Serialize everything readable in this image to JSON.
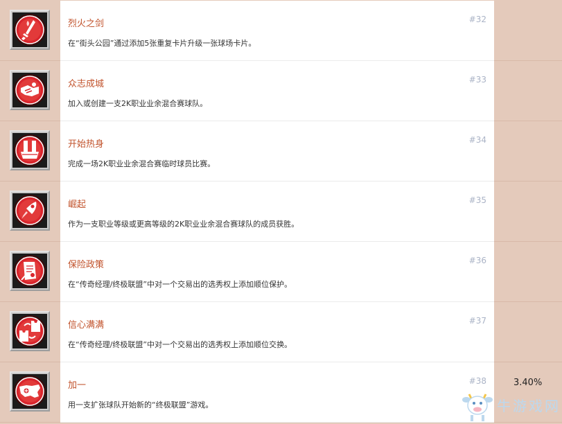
{
  "rows": [
    {
      "title": "烈火之剑",
      "desc": "在“街头公园”通过添加5张重复卡片升级一张球场卡片。",
      "num": "#32",
      "pct": "",
      "icon": "flaming-sword-icon"
    },
    {
      "title": "众志成城",
      "desc": "加入或创建一支2K职业业余混合赛球队。",
      "num": "#33",
      "pct": "",
      "icon": "handshake-icon"
    },
    {
      "title": "开始热身",
      "desc": "完成一场2K职业业余混合赛临时球员比赛。",
      "num": "#34",
      "pct": "",
      "icon": "warmup-bucket-icon"
    },
    {
      "title": "崛起",
      "desc": "作为一支职业等级或更高等级的2K职业业余混合赛球队的成员获胜。",
      "num": "#35",
      "pct": "",
      "icon": "rocket-icon"
    },
    {
      "title": "保险政策",
      "desc": "在“传奇经理/终极联盟”中对一个交易出的选秀权上添加顺位保护。",
      "num": "#36",
      "pct": "",
      "icon": "policy-document-icon"
    },
    {
      "title": "信心满满",
      "desc": "在“传奇经理/终极联盟”中对一个交易出的选秀权上添加顺位交换。",
      "num": "#37",
      "pct": "",
      "icon": "jersey-swap-icon"
    },
    {
      "title": "加一",
      "desc": "用一支扩张球队开始新的“终极联盟”游戏。",
      "num": "#38",
      "pct": "3.40%",
      "icon": "usa-map-icon"
    }
  ],
  "watermark": {
    "text": "牛游戏网",
    "icon": "cow-mascot-icon"
  },
  "colors": {
    "title": "#c1522b",
    "side_panel": "#e4cabb",
    "number": "#aab3c6",
    "badge_red": "#d9262e"
  }
}
